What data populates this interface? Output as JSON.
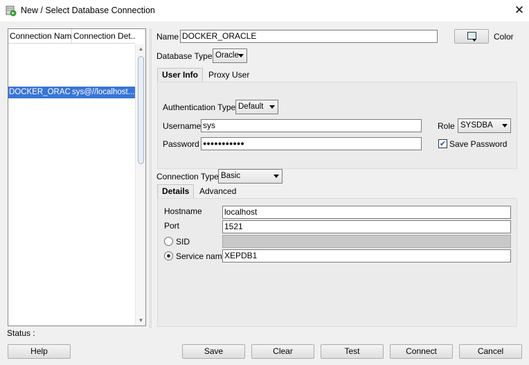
{
  "window": {
    "title": "New / Select Database Connection",
    "close_glyph": "✕"
  },
  "list": {
    "columns": [
      "Connection Name",
      "Connection Det..."
    ],
    "rows": [
      {
        "name": "DOCKER_ORACLE",
        "details": "sys@//localhost..."
      }
    ]
  },
  "form": {
    "name_label": "Name",
    "name_value": "DOCKER_ORACLE",
    "color_label": "Color",
    "color_swatch": "#dbf1f1",
    "db_type_label": "Database Type",
    "db_type_value": "Oracle",
    "tabs": [
      "User Info",
      "Proxy User"
    ],
    "auth_type_label": "Authentication Type",
    "auth_type_value": "Default",
    "username_label": "Username",
    "username_value": "sys",
    "password_label": "Password",
    "password_value": "●●●●●●●●●●●",
    "role_label": "Role",
    "role_value": "SYSDBA",
    "save_password_label": "Save Password",
    "save_password_checked": true,
    "conn_type_label": "Connection Type",
    "conn_type_value": "Basic",
    "detail_tabs": [
      "Details",
      "Advanced"
    ],
    "hostname_label": "Hostname",
    "hostname_value": "localhost",
    "port_label": "Port",
    "port_value": "1521",
    "sid_label": "SID",
    "sid_value": "",
    "service_name_label": "Service name",
    "service_name_value": "XEPDB1",
    "selected_option": "Service name"
  },
  "status_label": "Status :",
  "buttons": {
    "help": "Help",
    "save": "Save",
    "clear": "Clear",
    "test": "Test",
    "connect": "Connect",
    "cancel": "Cancel"
  }
}
